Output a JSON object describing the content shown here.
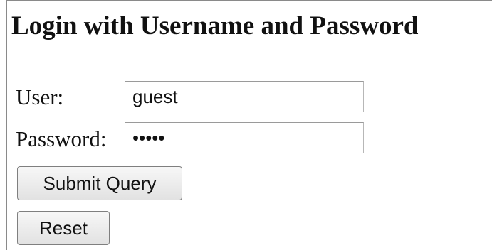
{
  "login": {
    "title": "Login with Username and Password",
    "user_label": "User:",
    "user_value": "guest",
    "password_label": "Password:",
    "password_value": "guest"
  },
  "buttons": {
    "submit_label": "Submit Query",
    "reset_label": "Reset"
  }
}
